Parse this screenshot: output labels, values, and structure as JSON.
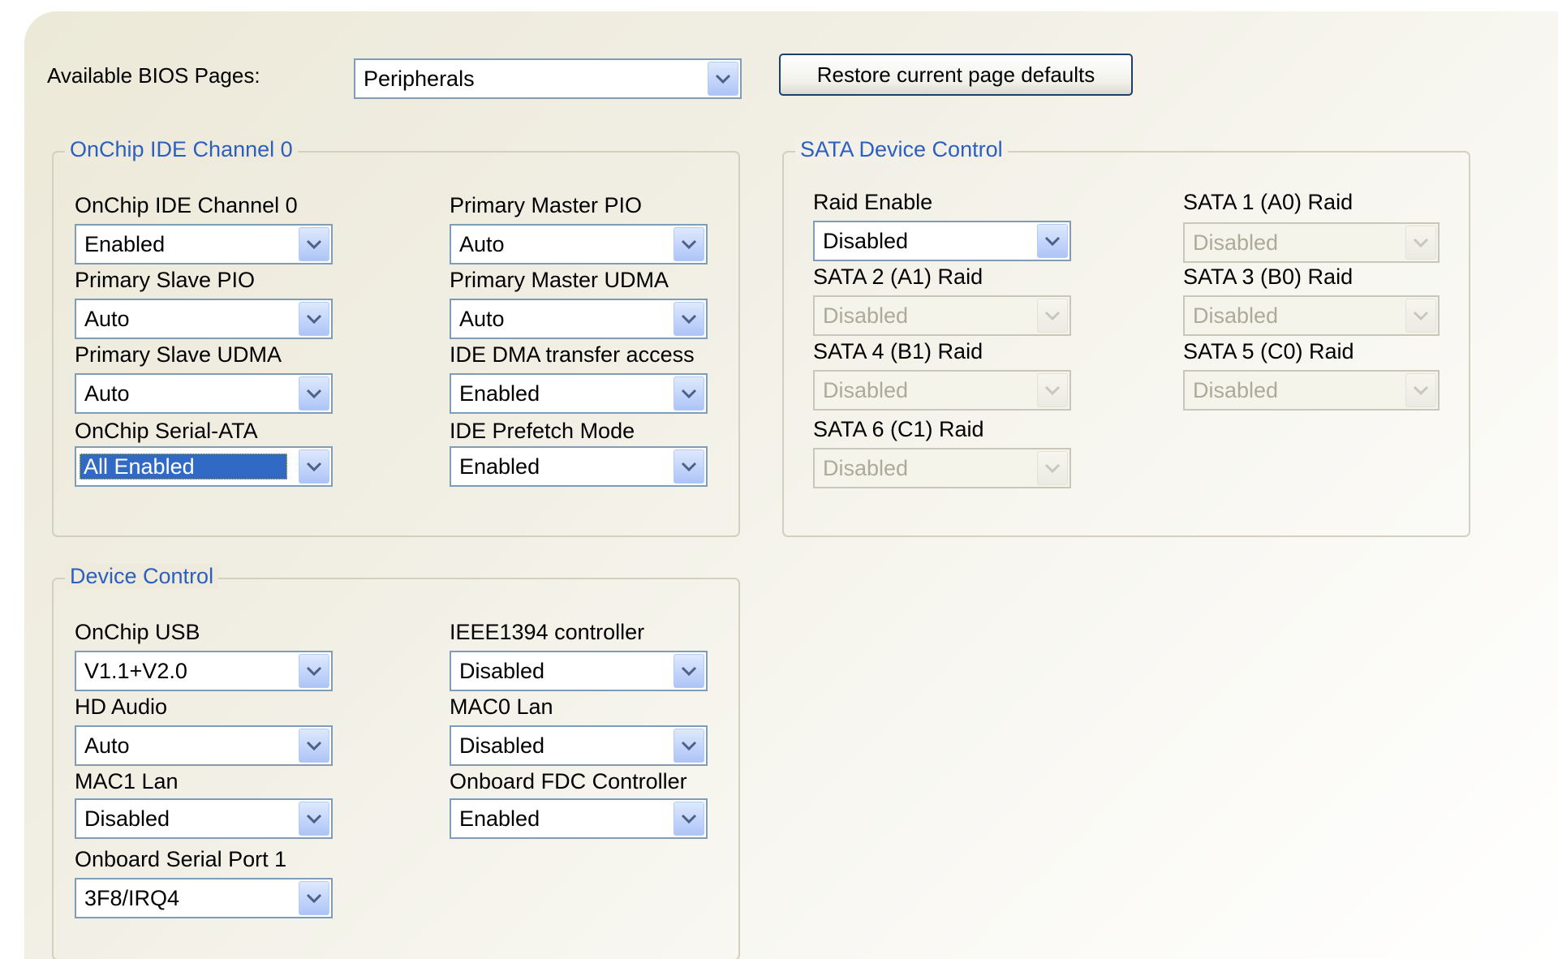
{
  "header": {
    "pages_label": "Available BIOS Pages:",
    "pages_value": "Peripherals",
    "restore_label": "Restore current page defaults"
  },
  "ide_group": {
    "title": "OnChip IDE Channel 0",
    "fields": [
      {
        "label": "OnChip IDE Channel 0",
        "value": "Enabled"
      },
      {
        "label": "Primary Master PIO",
        "value": "Auto"
      },
      {
        "label": "Primary Slave PIO",
        "value": "Auto"
      },
      {
        "label": "Primary Master UDMA",
        "value": "Auto"
      },
      {
        "label": "Primary Slave UDMA",
        "value": "Auto"
      },
      {
        "label": "IDE DMA transfer access",
        "value": "Enabled"
      },
      {
        "label": "OnChip Serial-ATA",
        "value": "All Enabled"
      },
      {
        "label": "IDE Prefetch Mode",
        "value": "Enabled"
      }
    ]
  },
  "sata_group": {
    "title": "SATA Device Control",
    "fields": [
      {
        "label": "Raid Enable",
        "value": "Disabled"
      },
      {
        "label": "SATA 1 (A0) Raid",
        "value": "Disabled"
      },
      {
        "label": "SATA 2 (A1) Raid",
        "value": "Disabled"
      },
      {
        "label": "SATA 3 (B0) Raid",
        "value": "Disabled"
      },
      {
        "label": "SATA 4 (B1) Raid",
        "value": "Disabled"
      },
      {
        "label": "SATA 5 (C0) Raid",
        "value": "Disabled"
      },
      {
        "label": "SATA 6 (C1) Raid",
        "value": "Disabled"
      }
    ]
  },
  "device_group": {
    "title": "Device Control",
    "fields": [
      {
        "label": "OnChip USB",
        "value": "V1.1+V2.0"
      },
      {
        "label": "IEEE1394 controller",
        "value": "Disabled"
      },
      {
        "label": "HD Audio",
        "value": "Auto"
      },
      {
        "label": "MAC0 Lan",
        "value": "Disabled"
      },
      {
        "label": "MAC1 Lan",
        "value": "Disabled"
      },
      {
        "label": "Onboard FDC Controller",
        "value": "Enabled"
      },
      {
        "label": "Onboard Serial Port 1",
        "value": "3F8/IRQ4"
      }
    ]
  },
  "colors": {
    "group_title": "#2b5fc0",
    "selection": "#316ac5",
    "select_border": "#7f9db9"
  }
}
